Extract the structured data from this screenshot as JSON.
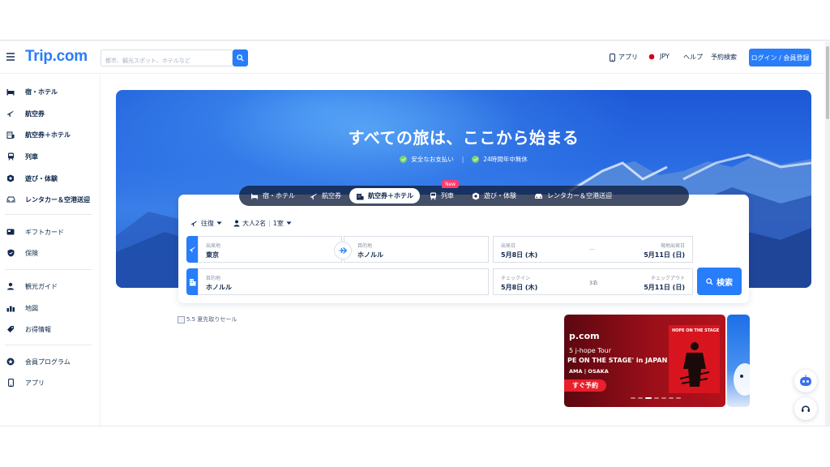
{
  "header": {
    "logo": "Trip.com",
    "search_placeholder": "都市、観光スポット、ホテルなど",
    "app_label": "アプリ",
    "currency": "JPY",
    "help": "ヘルプ",
    "bookings": "予約検索",
    "login": "ログイン / 会員登録"
  },
  "sidebar": {
    "items": [
      {
        "label": "宿・ホテル",
        "icon": "hotel-icon"
      },
      {
        "label": "航空券",
        "icon": "plane-icon"
      },
      {
        "label": "航空券＋ホテル",
        "icon": "flight-hotel-icon"
      },
      {
        "label": "列車",
        "icon": "train-icon"
      },
      {
        "label": "遊び・体験",
        "icon": "ticket-icon"
      },
      {
        "label": "レンタカー＆空港送迎",
        "icon": "car-icon"
      },
      {
        "label": "ギフトカード",
        "icon": "gift-card-icon"
      },
      {
        "label": "保険",
        "icon": "shield-icon"
      },
      {
        "label": "観光ガイド",
        "icon": "guide-icon"
      },
      {
        "label": "地図",
        "icon": "map-icon"
      },
      {
        "label": "お得情報",
        "icon": "tag-icon"
      },
      {
        "label": "会員プログラム",
        "icon": "member-icon"
      },
      {
        "label": "アプリ",
        "icon": "phone-icon"
      }
    ]
  },
  "hero": {
    "title": "すべての旅は、ここから始まる",
    "badge1": "安全なお支払い",
    "separator": "|",
    "badge2": "24時間年中無休"
  },
  "tabs": [
    {
      "label": "宿・ホテル",
      "active": false
    },
    {
      "label": "航空券",
      "active": false
    },
    {
      "label": "航空券＋ホテル",
      "active": true
    },
    {
      "label": "列車",
      "active": false
    },
    {
      "label": "遊び・体験",
      "active": false
    },
    {
      "label": "レンタカー＆空港送迎",
      "active": false
    }
  ],
  "new_badge": "New",
  "search": {
    "trip_type": "往復",
    "travelers": "大人2名",
    "rooms": "1室",
    "origin_label": "出発地",
    "origin_value": "東京",
    "dest_label": "目的地",
    "dest_value": "ホノルル",
    "depart_label": "出発日",
    "depart_value": "5月8日 (木)",
    "date_dash": "—",
    "return_label": "現地出発日",
    "return_value": "5月11日 (日)",
    "hotel_dest_label": "目的地",
    "hotel_dest_value": "ホノルル",
    "checkin_label": "チェックイン",
    "checkin_value": "5月8日 (木)",
    "nights": "3泊",
    "checkout_label": "チェックアウト",
    "checkout_value": "5月11日 (日)",
    "button": "検索"
  },
  "promo": {
    "sale_alt": "5.5 夏先取りセール",
    "banner_brand": "p.com",
    "banner_line1": "5  j-hope Tour",
    "banner_line2": "PE ON THE STAGE' in JAPAN",
    "banner_line3": "AMA | OSAKA",
    "banner_cta": "すぐ予約",
    "poster_text": "HOPE ON THE STAGE"
  },
  "colors": {
    "brand": "#287dfa",
    "text": "#0f294d",
    "new_badge": "#ff3c6e"
  }
}
